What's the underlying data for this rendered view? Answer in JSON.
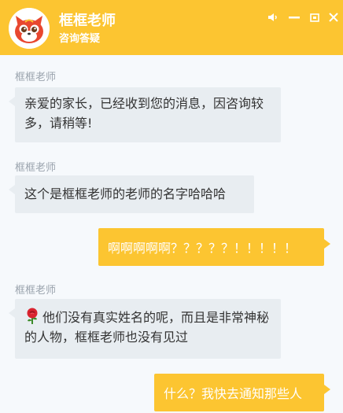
{
  "header": {
    "title": "框框老师",
    "subtitle": "咨询答疑",
    "avatar_icon": "fox-mascot-icon",
    "controls": [
      "volume-icon",
      "minimize-icon",
      "restore-icon",
      "close-icon"
    ]
  },
  "colors": {
    "accent": "#fcc531",
    "incoming_bubble": "#e8edf1",
    "background": "#f6f9fc"
  },
  "messages": [
    {
      "sender": "框框老师",
      "text": "亲爱的家长，已经收到您的消息，因咨询较多，请稍等!"
    },
    {
      "sender": "框框老师",
      "text": "这个是框框老师的老师的名字哈哈哈"
    },
    {
      "sender": "",
      "text": "啊啊啊啊啊？？？？？！！！！！"
    },
    {
      "sender": "框框老师",
      "text": "他们没有真实姓名的呢，而且是非常神秘的人物，框框老师也没有见过",
      "emoji": "rose-icon"
    },
    {
      "sender": "",
      "text": "什么？我快去通知那些人"
    }
  ]
}
